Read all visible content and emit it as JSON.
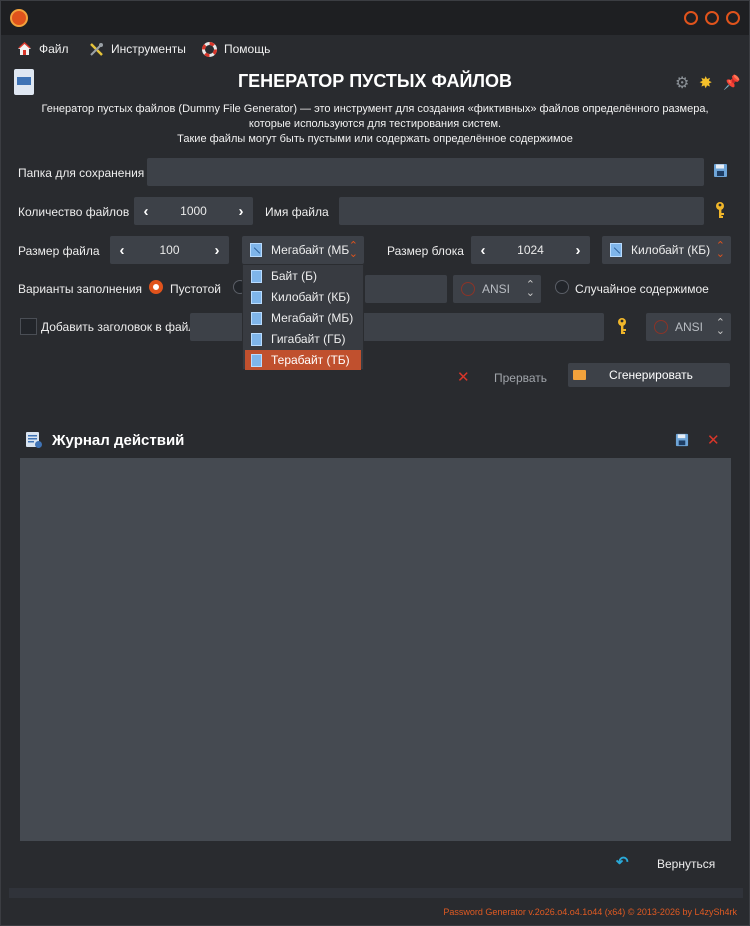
{
  "menu": {
    "file": "Файл",
    "tools": "Инструменты",
    "help": "Помощь"
  },
  "header": {
    "title": "ГЕНЕРАТОР ПУСТЫХ ФАЙЛОВ",
    "description_line1": "Генератор пустых файлов (Dummy File Generator) — это инструмент для создания «фиктивных» файлов определённого размера,",
    "description_line2": "которые используются для тестирования систем.",
    "description_line3": "Такие файлы могут быть пустыми или содержать определённое содержимое"
  },
  "form": {
    "save_folder_label": "Папка для сохранения",
    "save_folder_value": "",
    "file_count_label": "Количество файлов",
    "file_count_value": "1000",
    "file_name_label": "Имя файла",
    "file_name_value": "",
    "file_size_label": "Размер файла",
    "file_size_value": "100",
    "file_size_unit": "Мегабайт (МБ",
    "block_size_label": "Размер блока",
    "block_size_value": "1024",
    "block_size_unit": "Килобайт (КБ)",
    "fill_label": "Варианты заполнения",
    "fill_empty": "Пустотой",
    "fill_encoding": "ANSI",
    "fill_random": "Случайное содержимое",
    "header_checkbox_label": "Добавить заголовок в файл",
    "header_encoding": "ANSI"
  },
  "dropdown": {
    "options": [
      "Байт (Б)",
      "Килобайт (КБ)",
      "Мегабайт (МБ)",
      "Гигабайт (ГБ)",
      "Терабайт (ТБ)"
    ]
  },
  "actions": {
    "abort_label": "Прервать",
    "generate_label": "Сгенерировать"
  },
  "log": {
    "title": "Журнал действий"
  },
  "footer": {
    "back_label": "Вернуться",
    "copyright": "Password Generator v.2o26.o4.o4.1o44 (x64) © 2013-2026 by L4zySh4rk"
  },
  "colors": {
    "accent": "#e0531c",
    "selection": "#c0502e",
    "background": "#292b2f",
    "field": "#3d4148"
  },
  "icons": {
    "app": "app-logo-icon",
    "file_menu": "home-icon",
    "tools_menu": "tools-icon",
    "help_menu": "lifebuoy-icon",
    "settings": "gear-icon",
    "theme": "sun-icon",
    "pin": "pin-icon",
    "save_folder": "save-icon",
    "key": "key-icon",
    "abort": "close-icon",
    "log_save": "save-icon",
    "log_clear": "close-icon",
    "back": "undo-icon"
  }
}
